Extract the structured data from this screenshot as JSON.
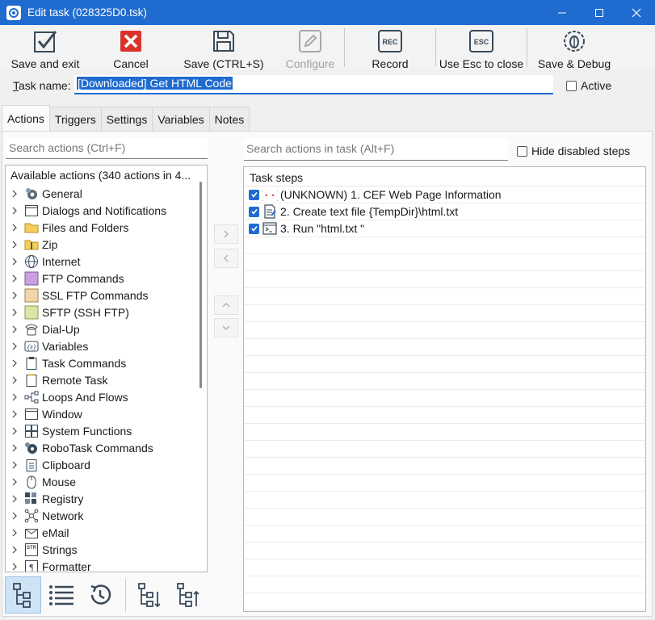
{
  "window": {
    "title": "Edit task (028325D0.tsk)"
  },
  "toolbar": {
    "save_exit": "Save and exit",
    "cancel": "Cancel",
    "save": "Save (CTRL+S)",
    "configure": "Configure",
    "record": "Record",
    "esc_close": "Use Esc to close",
    "save_debug": "Save & Debug",
    "record_icon_text": "REC",
    "esc_icon_text": "ESC"
  },
  "task": {
    "name_label_u": "T",
    "name_label_rest": "ask name:",
    "name_value": "[Downloaded] Get HTML Code",
    "active_label": "Active"
  },
  "tabs": [
    "Actions",
    "Triggers",
    "Settings",
    "Variables",
    "Notes"
  ],
  "search": {
    "actions_placeholder": "Search actions (Ctrl+F)",
    "task_placeholder": "Search actions in task (Alt+F)",
    "hide_disabled": "Hide disabled steps"
  },
  "tree": {
    "header": "Available actions (340 actions in 4...",
    "items": [
      {
        "label": "General",
        "icon": "gear-icon"
      },
      {
        "label": "Dialogs and Notifications",
        "icon": "dialog-icon"
      },
      {
        "label": "Files and Folders",
        "icon": "folder-icon"
      },
      {
        "label": "Zip",
        "icon": "zip-folder-icon"
      },
      {
        "label": "Internet",
        "icon": "globe-icon"
      },
      {
        "label": "FTP Commands",
        "icon": "ftp-icon"
      },
      {
        "label": "SSL FTP Commands",
        "icon": "ssl-ftp-icon"
      },
      {
        "label": "SFTP (SSH FTP)",
        "icon": "sftp-icon"
      },
      {
        "label": "Dial-Up",
        "icon": "phone-icon"
      },
      {
        "label": "Variables",
        "icon": "variable-icon"
      },
      {
        "label": "Task Commands",
        "icon": "clipboard-icon"
      },
      {
        "label": "Remote Task",
        "icon": "remote-task-icon"
      },
      {
        "label": "Loops And Flows",
        "icon": "flow-icon"
      },
      {
        "label": "Window",
        "icon": "window-icon"
      },
      {
        "label": "System Functions",
        "icon": "windows-icon"
      },
      {
        "label": "RoboTask Commands",
        "icon": "robotask-icon"
      },
      {
        "label": "Clipboard",
        "icon": "clipboard-list-icon"
      },
      {
        "label": "Mouse",
        "icon": "mouse-icon"
      },
      {
        "label": "Registry",
        "icon": "registry-icon"
      },
      {
        "label": "Network",
        "icon": "network-icon"
      },
      {
        "label": "eMail",
        "icon": "email-icon"
      },
      {
        "label": "Strings",
        "icon": "strings-icon"
      },
      {
        "label": "Formatter",
        "icon": "formatter-icon"
      }
    ]
  },
  "steps": {
    "header": "Task steps",
    "items": [
      {
        "label": "(UNKNOWN) 1. CEF Web Page Information",
        "icon": "unknown-braces-icon"
      },
      {
        "label": "2. Create text file {TempDir}\\html.txt",
        "icon": "text-file-icon"
      },
      {
        "label": "3. Run \"html.txt \"",
        "icon": "console-icon"
      }
    ]
  },
  "colors": {
    "accent": "#1f6bcf",
    "titlebar": "#1f6bcf"
  }
}
